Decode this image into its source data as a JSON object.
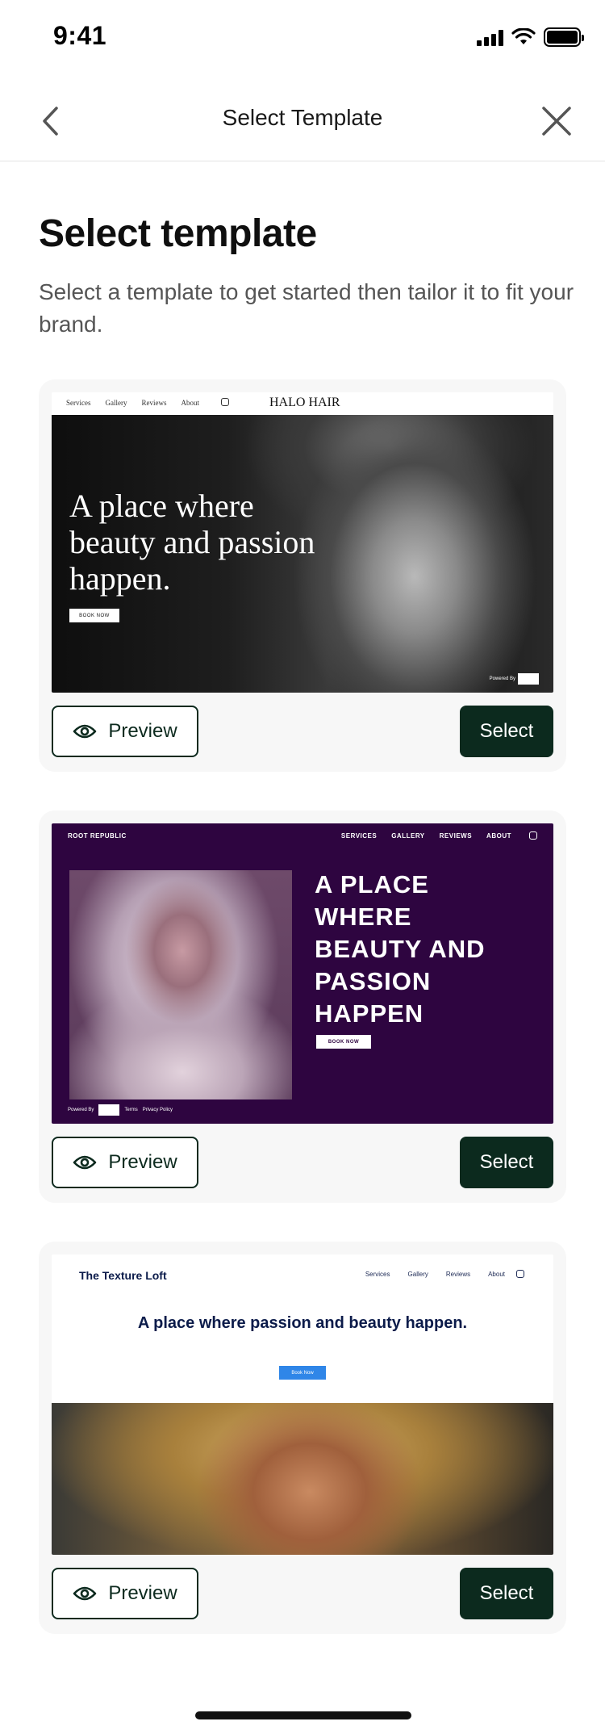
{
  "status_bar": {
    "time": "9:41"
  },
  "nav": {
    "title": "Select Template"
  },
  "page": {
    "heading": "Select template",
    "subtitle": "Select a template to get started then tailor it to fit your brand."
  },
  "templates": [
    {
      "brand": "HALO HAIR",
      "nav_links": [
        "Services",
        "Gallery",
        "Reviews",
        "About"
      ],
      "headline": "A place where beauty and passion happen.",
      "cta": "BOOK NOW",
      "footer": "Powered By",
      "preview_label": "Preview",
      "select_label": "Select"
    },
    {
      "brand": "ROOT REPUBLIC",
      "nav_links": [
        "SERVICES",
        "GALLERY",
        "REVIEWS",
        "ABOUT"
      ],
      "headline": "A PLACE WHERE BEAUTY AND PASSION HAPPEN",
      "cta": "BOOK NOW",
      "footer": "Powered By",
      "footer_links": [
        "Terms",
        "Privacy Policy"
      ],
      "preview_label": "Preview",
      "select_label": "Select"
    },
    {
      "brand": "The Texture Loft",
      "nav_links": [
        "Services",
        "Gallery",
        "Reviews",
        "About"
      ],
      "headline": "A place where passion and beauty happen.",
      "cta": "Book Now",
      "preview_label": "Preview",
      "select_label": "Select"
    }
  ],
  "colors": {
    "primary": "#0c2a1e",
    "root_republic_bg": "#2e0540",
    "texture_loft_accent": "#2f86e8"
  },
  "icons": {
    "back": "chevron-left-icon",
    "close": "close-icon",
    "preview": "eye-icon"
  }
}
